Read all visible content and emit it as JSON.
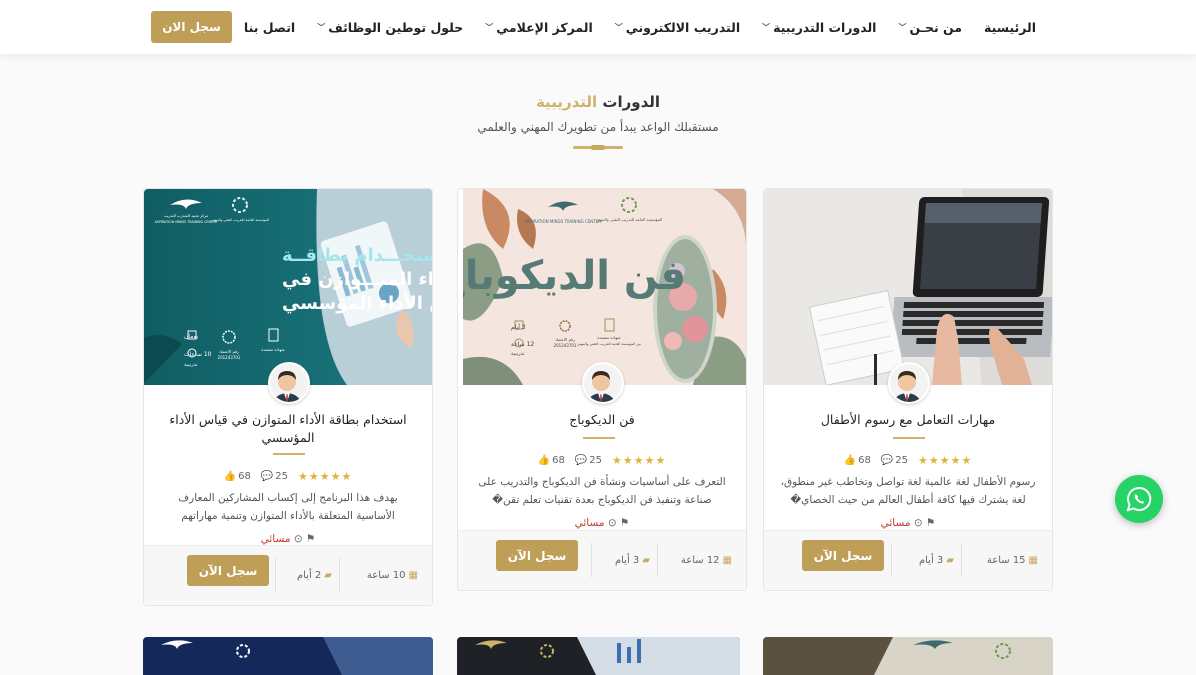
{
  "nav": {
    "items": [
      {
        "label": "الرئيسية",
        "chevron": false
      },
      {
        "label": "من نحـن",
        "chevron": true
      },
      {
        "label": "الدورات التدريبية",
        "chevron": true
      },
      {
        "label": "التدريب الالكتروني",
        "chevron": true
      },
      {
        "label": "المركز الإعلامي",
        "chevron": true
      },
      {
        "label": "حلول توطين الوظائف",
        "chevron": true
      },
      {
        "label": "اتصل بنا",
        "chevron": false
      }
    ],
    "cta_label": "سجل الان"
  },
  "section": {
    "title_main": "الدورات",
    "title_accent": "التدريبية",
    "subtitle": "مستقبلك الواعد يبدأ من تطويرك المهني والعلمي"
  },
  "cards": [
    {
      "title": "مهارات التعامل مع رسوم الأطفال",
      "likes": "68",
      "comments": "25",
      "stars": "★★★★★",
      "description": "رسوم الأطفال لغة عالمية لغة تواصل وتخاطب غير منطوق، لغة يشترك فيها كافة أطفال العالم من حيث الخصاي�",
      "period": "مسائي",
      "hours": "15 ساعة",
      "days": "3 أيام",
      "register_label": "سجل الآن"
    },
    {
      "title": "فن الديكوباج",
      "likes": "68",
      "comments": "25",
      "stars": "★★★★★",
      "description": "التعرف على أساسيات ونشأة فن الديكوباج والتدريب على صناعة وتنفيذ فن الديكوباج بعدة تقنيات تعلم تقن�",
      "period": "مسائي",
      "hours": "12 ساعة",
      "days": "3 أيام",
      "register_label": "سجل الآن",
      "poster": {
        "headline": "فن الديكوباج",
        "days": "3 أيام",
        "hours": "12 ساعة",
        "hours_unit": "تدريبية",
        "cert": "شهادة معتمدة",
        "cert_sub": "من المؤسسة العامة للتدريب التقني والمهني",
        "license": "رقم الاعتماد",
        "license_no": "201243701",
        "logo_en": "ASPIRATION MINDS TRAINING CENTER",
        "logo_tvtc": "المؤسسة العامة للتدريب التقني والمهني"
      }
    },
    {
      "title": "استخدام بطاقة الأداء المتوازن في قياس الأداء المؤسسي",
      "likes": "68",
      "comments": "25",
      "stars": "★★★★★",
      "description": "يهدف هذا البرنامج إلى إكساب المشاركين المعارف الأساسية المتعلقة بالأداء المتوازن وتنمية مهاراتهم",
      "period": "مسائي",
      "hours": "10 ساعة",
      "days": "2 أيام",
      "register_label": "سجل الآن",
      "poster": {
        "line1": "استخـــدام بطاقــة",
        "line2": "الأداء المتـــوازن في",
        "line3": "قياس الأداء المؤسسي",
        "days": "يومان",
        "hours": "10 ساعات",
        "hours_unit": "تدريبية",
        "cert": "شهادة معتمدة",
        "license": "رقم الاعتماد",
        "license_no": "201243701",
        "logo_ar": "مركز تجنيد المتدرب التدريب",
        "logo_en": "ASPIRATION MINDS TRAINING CENTER",
        "logo_tvtc": "المؤسسة العامة للتدريب التقني والمهني"
      }
    }
  ],
  "icons": {
    "like": "thumbs-up-icon",
    "comment": "comment-icon",
    "clock": "clock-icon",
    "flag": "flag-icon",
    "calendar": "calendar-icon",
    "book": "book-icon",
    "whatsapp": "whatsapp-icon"
  },
  "colors": {
    "gold": "#bf9e57",
    "accent": "#d0b26c",
    "teal": "#1a6b72",
    "whatsapp": "#25d366"
  }
}
